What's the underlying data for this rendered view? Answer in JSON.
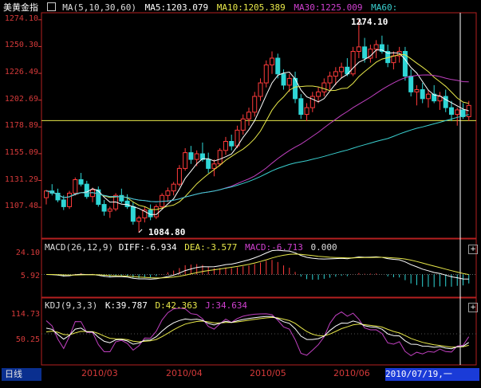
{
  "header": {
    "title": "美黄金指",
    "ma_formula": "MA(5,10,30,60)",
    "ma5": "MA5:1203.079",
    "ma10": "MA10:1205.389",
    "ma30": "MA30:1225.009",
    "ma60": "MA60:"
  },
  "price_axis": [
    "1274.10",
    "1250.30",
    "1226.49",
    "1202.69",
    "1178.89",
    "1155.09",
    "1131.29",
    "1107.48"
  ],
  "price_labels": {
    "high": "1274.10",
    "low": "1084.80"
  },
  "macd": {
    "formula": "MACD(26,12,9)",
    "diff": "DIFF:-6.934",
    "dea": "DEA:-3.577",
    "macd": "MACD:-6.713",
    "extra": "0.000",
    "axis": [
      "24.10",
      "5.92"
    ]
  },
  "kdj": {
    "formula": "KDJ(9,3,3)",
    "k": "K:39.787",
    "d": "D:42.363",
    "j": "J:34.634",
    "axis": [
      "114.73",
      "50.25"
    ]
  },
  "footer": {
    "period": "日线",
    "months": [
      "2010/03",
      "2010/04",
      "2010/05",
      "2010/06"
    ],
    "cursor_date": "2010/07/19,一"
  },
  "colors": {
    "up": "#ff3b3b",
    "down": "#2fd6d6",
    "ma5": "#ffffff",
    "ma10": "#e8e84a",
    "ma30": "#c040c0",
    "ma60": "#3ad0d0",
    "axis": "#d63a3a",
    "grid": "#7a1010"
  },
  "chart_data": {
    "type": "candlestick",
    "price_range": [
      1084.8,
      1274.1
    ],
    "candles": [
      [
        1116,
        1123,
        1110,
        1122
      ],
      [
        1122,
        1128,
        1118,
        1120
      ],
      [
        1120,
        1124,
        1112,
        1114
      ],
      [
        1114,
        1118,
        1105,
        1108
      ],
      [
        1108,
        1122,
        1106,
        1120
      ],
      [
        1120,
        1134,
        1118,
        1132
      ],
      [
        1132,
        1138,
        1126,
        1128
      ],
      [
        1128,
        1131,
        1115,
        1117
      ],
      [
        1117,
        1125,
        1112,
        1123
      ],
      [
        1123,
        1126,
        1108,
        1110
      ],
      [
        1110,
        1114,
        1100,
        1104
      ],
      [
        1104,
        1108,
        1098,
        1106
      ],
      [
        1106,
        1120,
        1104,
        1118
      ],
      [
        1118,
        1124,
        1111,
        1113
      ],
      [
        1113,
        1119,
        1106,
        1108
      ],
      [
        1108,
        1112,
        1092,
        1095
      ],
      [
        1095,
        1100,
        1085,
        1098
      ],
      [
        1098,
        1108,
        1094,
        1105
      ],
      [
        1105,
        1110,
        1096,
        1099
      ],
      [
        1099,
        1110,
        1097,
        1108
      ],
      [
        1108,
        1120,
        1106,
        1118
      ],
      [
        1118,
        1125,
        1112,
        1122
      ],
      [
        1122,
        1130,
        1118,
        1128
      ],
      [
        1128,
        1145,
        1126,
        1142
      ],
      [
        1142,
        1160,
        1140,
        1156
      ],
      [
        1156,
        1162,
        1146,
        1150
      ],
      [
        1150,
        1158,
        1144,
        1155
      ],
      [
        1155,
        1165,
        1148,
        1150
      ],
      [
        1150,
        1156,
        1138,
        1142
      ],
      [
        1142,
        1150,
        1135,
        1146
      ],
      [
        1146,
        1160,
        1144,
        1158
      ],
      [
        1158,
        1170,
        1154,
        1166
      ],
      [
        1166,
        1172,
        1158,
        1162
      ],
      [
        1162,
        1180,
        1160,
        1176
      ],
      [
        1176,
        1190,
        1172,
        1186
      ],
      [
        1186,
        1196,
        1180,
        1192
      ],
      [
        1192,
        1210,
        1188,
        1206
      ],
      [
        1206,
        1222,
        1202,
        1218
      ],
      [
        1218,
        1238,
        1214,
        1234
      ],
      [
        1234,
        1246,
        1226,
        1240
      ],
      [
        1240,
        1244,
        1222,
        1226
      ],
      [
        1226,
        1230,
        1212,
        1216
      ],
      [
        1216,
        1226,
        1210,
        1222
      ],
      [
        1222,
        1228,
        1200,
        1204
      ],
      [
        1204,
        1208,
        1186,
        1190
      ],
      [
        1190,
        1200,
        1184,
        1196
      ],
      [
        1196,
        1210,
        1192,
        1206
      ],
      [
        1206,
        1214,
        1200,
        1210
      ],
      [
        1210,
        1222,
        1206,
        1218
      ],
      [
        1218,
        1228,
        1212,
        1224
      ],
      [
        1224,
        1232,
        1216,
        1228
      ],
      [
        1228,
        1236,
        1222,
        1232
      ],
      [
        1232,
        1240,
        1224,
        1226
      ],
      [
        1226,
        1250,
        1224,
        1246
      ],
      [
        1246,
        1274,
        1240,
        1250
      ],
      [
        1250,
        1258,
        1236,
        1240
      ],
      [
        1240,
        1252,
        1236,
        1248
      ],
      [
        1248,
        1256,
        1240,
        1252
      ],
      [
        1252,
        1260,
        1244,
        1246
      ],
      [
        1246,
        1252,
        1232,
        1236
      ],
      [
        1236,
        1246,
        1230,
        1242
      ],
      [
        1242,
        1250,
        1236,
        1246
      ],
      [
        1246,
        1250,
        1220,
        1224
      ],
      [
        1224,
        1230,
        1206,
        1210
      ],
      [
        1210,
        1216,
        1198,
        1212
      ],
      [
        1212,
        1218,
        1200,
        1204
      ],
      [
        1204,
        1212,
        1196,
        1208
      ],
      [
        1208,
        1216,
        1200,
        1202
      ],
      [
        1202,
        1210,
        1194,
        1206
      ],
      [
        1206,
        1212,
        1192,
        1196
      ],
      [
        1196,
        1202,
        1184,
        1190
      ],
      [
        1190,
        1196,
        1180,
        1194
      ],
      [
        1194,
        1200,
        1186,
        1188
      ],
      [
        1188,
        1202,
        1184,
        1198
      ]
    ]
  }
}
